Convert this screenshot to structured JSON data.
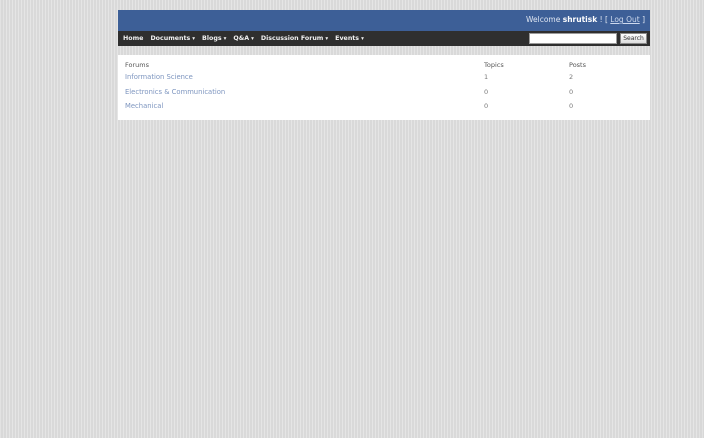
{
  "header": {
    "welcome_prefix": "Welcome",
    "username": "shrutisk",
    "logout_open": " ! [ ",
    "logout_label": "Log Out",
    "logout_close": " ]"
  },
  "nav": {
    "items": [
      {
        "label": "Home",
        "has_dropdown": false
      },
      {
        "label": "Documents",
        "has_dropdown": true
      },
      {
        "label": "Blogs",
        "has_dropdown": true
      },
      {
        "label": "Q&A",
        "has_dropdown": true
      },
      {
        "label": "Discussion Forum",
        "has_dropdown": true
      },
      {
        "label": "Events",
        "has_dropdown": true
      }
    ],
    "caret": "▾",
    "search_value": "",
    "search_placeholder": "",
    "search_button_label": "Search"
  },
  "forums": {
    "columns": {
      "forum": "Forums",
      "topics": "Topics",
      "posts": "Posts"
    },
    "rows": [
      {
        "name": "Information Science",
        "topics": "1",
        "posts": "2"
      },
      {
        "name": "Electronics & Communication",
        "topics": "0",
        "posts": "0"
      },
      {
        "name": "Mechanical",
        "topics": "0",
        "posts": "0"
      }
    ]
  },
  "colors": {
    "header_blue": "#3d5f97",
    "nav_dark": "#2f2f2f",
    "link_blue": "#7d95bf",
    "page_gray": "#dcdcdc"
  }
}
